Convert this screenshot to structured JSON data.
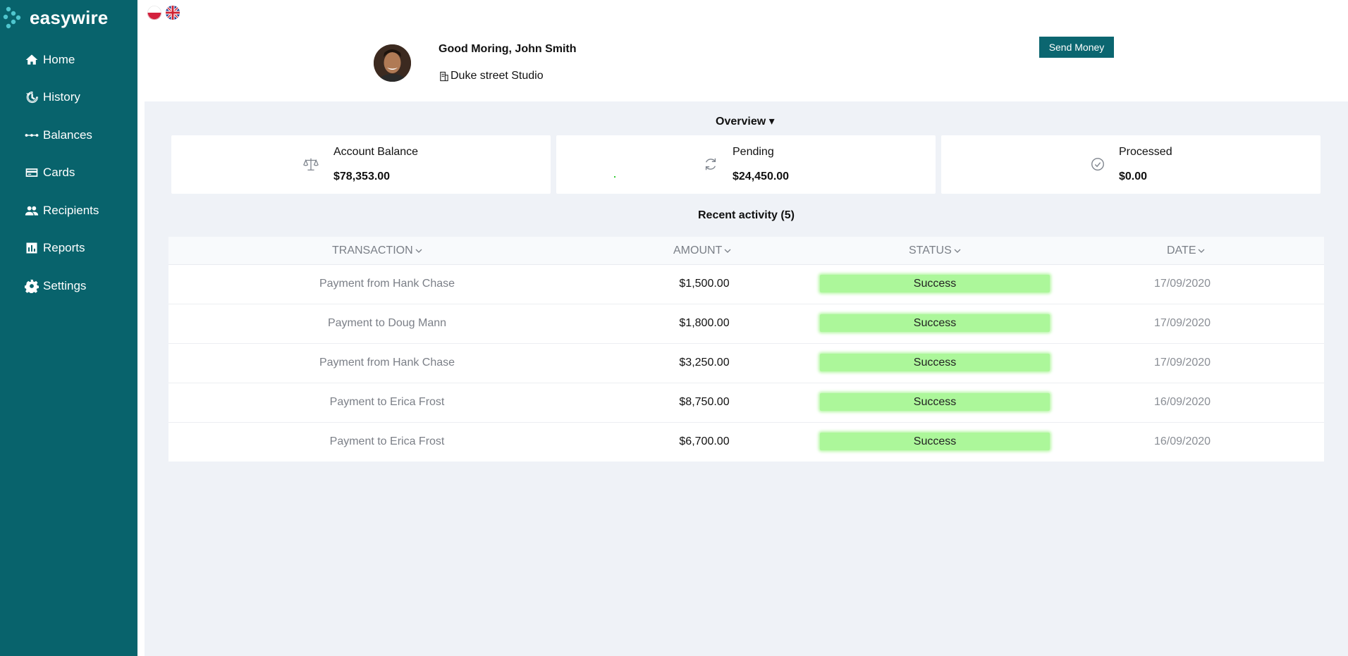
{
  "app": {
    "brand": "easywire"
  },
  "sidebar": {
    "items": [
      {
        "label": "Home",
        "icon": "home-icon"
      },
      {
        "label": "History",
        "icon": "history-icon"
      },
      {
        "label": "Balances",
        "icon": "balances-icon"
      },
      {
        "label": "Cards",
        "icon": "card-icon"
      },
      {
        "label": "Recipients",
        "icon": "users-icon"
      },
      {
        "label": "Reports",
        "icon": "chart-icon"
      },
      {
        "label": "Settings",
        "icon": "gear-icon"
      }
    ]
  },
  "header": {
    "languages": [
      "pl",
      "en"
    ],
    "greeting": "Good Moring, John Smith",
    "studio": "Duke street Studio",
    "send_button": "Send Money"
  },
  "overview": {
    "title": "Overview ▾",
    "cards": [
      {
        "label": "Account Balance",
        "value": "$78,353.00",
        "icon": "scale-icon"
      },
      {
        "label": "Pending",
        "value": "$24,450.00",
        "icon": "refresh-icon"
      },
      {
        "label": "Processed",
        "value": "$0.00",
        "icon": "check-circle-icon"
      }
    ]
  },
  "recent": {
    "title": "Recent activity (5)",
    "columns": [
      "TRANSACTION",
      "AMOUNT",
      "STATUS",
      "DATE"
    ],
    "rows": [
      {
        "transaction": "Payment from Hank Chase",
        "amount": "$1,500.00",
        "status": "Success",
        "date": "17/09/2020"
      },
      {
        "transaction": "Payment to Doug Mann",
        "amount": "$1,800.00",
        "status": "Success",
        "date": "17/09/2020"
      },
      {
        "transaction": "Payment from Hank Chase",
        "amount": "$3,250.00",
        "status": "Success",
        "date": "17/09/2020"
      },
      {
        "transaction": "Payment to Erica Frost",
        "amount": "$8,750.00",
        "status": "Success",
        "date": "16/09/2020"
      },
      {
        "transaction": "Payment to Erica Frost",
        "amount": "$6,700.00",
        "status": "Success",
        "date": "16/09/2020"
      }
    ]
  },
  "colors": {
    "sidebar": "#08636c",
    "accent": "#0b6670",
    "background": "#eff2f7",
    "success": "#acf79a"
  }
}
